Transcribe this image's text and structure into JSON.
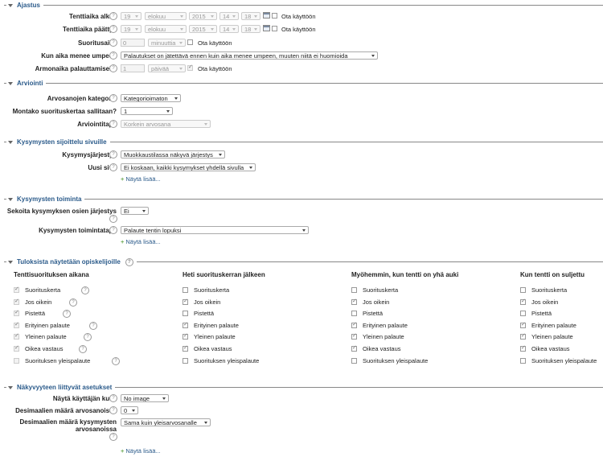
{
  "sections": {
    "timing": {
      "title": "Ajastus"
    },
    "grading": {
      "title": "Arviointi"
    },
    "layout": {
      "title": "Kysymysten sijoittelu sivuille"
    },
    "behaviour": {
      "title": "Kysymysten toiminta"
    },
    "review": {
      "title": "Tuloksista näytetään opiskelijoille"
    },
    "appearance": {
      "title": "Näkyvyyteen liittyvät asetukset"
    }
  },
  "timing": {
    "open_label": "Tenttiaika alkaa",
    "close_label": "Tenttiaika päättyy",
    "open": {
      "day": "19",
      "month": "elokuu",
      "year": "2015",
      "hour": "14",
      "minute": "18"
    },
    "close": {
      "day": "19",
      "month": "elokuu",
      "year": "2015",
      "hour": "14",
      "minute": "18"
    },
    "enable_label": "Ota käyttöön",
    "limit_label": "Suoritusaika",
    "limit_value": "0",
    "limit_unit": "minuuttia",
    "overdue_label": "Kun aika menee umpeen",
    "overdue_value": "Palautukset on jätettävä ennen kuin aika menee umpeen, muuten niitä ei huomioida",
    "grace_label": "Armonaika palauttamiselle",
    "grace_value": "1",
    "grace_unit": "päivää"
  },
  "grading": {
    "category_label": "Arvosanojen kategoria",
    "category_value": "Kategorioimaton",
    "attempts_label": "Montako suorituskertaa sallitaan?",
    "attempts_value": "1",
    "method_label": "Arviointitapa",
    "method_value": "Korkein arvosana"
  },
  "layout": {
    "order_label": "Kysymysjärjestys",
    "order_value": "Muokkaustilassa näkyvä järjestys",
    "newpage_label": "Uusi sivu",
    "newpage_value": "Ei koskaan, kaikki kysymykset yhdellä sivulla",
    "more": "Näytä lisää..."
  },
  "behaviour": {
    "shuffle_label": "Sekoita kysymyksen osien järjestys",
    "shuffle_value": "Ei",
    "mode_label": "Kysymysten toimintatapa",
    "mode_value": "Palaute tentin lopuksi",
    "more": "Näytä lisää..."
  },
  "review": {
    "columns": [
      "Tenttisuorituksen aikana",
      "Heti suorituskerran jälkeen",
      "Myöhemmin, kun tentti on yhä auki",
      "Kun tentti on suljettu"
    ],
    "items": [
      "Suorituskerta",
      "Jos oikein",
      "Pistettä",
      "Erityinen palaute",
      "Yleinen palaute",
      "Oikea vastaus",
      "Suorituksen yleispalaute"
    ],
    "checked": [
      [
        true,
        true,
        true,
        true,
        true,
        true,
        false
      ],
      [
        false,
        true,
        false,
        true,
        true,
        true,
        false
      ],
      [
        false,
        true,
        false,
        true,
        true,
        true,
        false
      ],
      [
        false,
        true,
        false,
        true,
        true,
        true,
        false
      ]
    ]
  },
  "appearance": {
    "picture_label": "Näytä käyttäjän kuva",
    "picture_value": "No image",
    "decimals_label": "Desimaalien määrä arvosanoissa",
    "decimals_value": "0",
    "qdecimals_label": "Desimaalien määrä kysymysten arvosanoissa",
    "qdecimals_value": "Sama kuin yleisarvosanalle",
    "more": "Näytä lisää..."
  },
  "icons": {
    "help": "help-icon",
    "calendar": "calendar-icon",
    "expand": "expand-icon"
  },
  "colors": {
    "heading": "#2a5a8a",
    "link": "#2a5a8a",
    "plus": "#6aa84f"
  }
}
